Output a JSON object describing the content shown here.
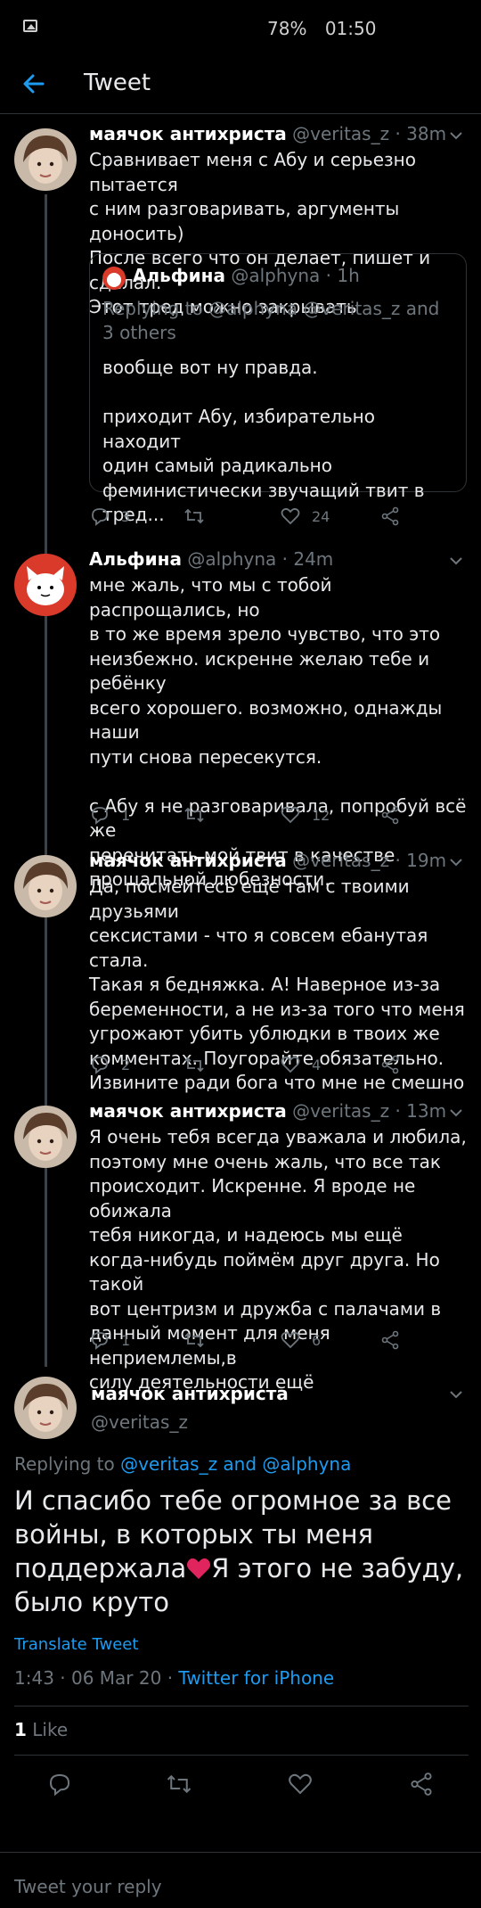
{
  "status_bar": {
    "battery": "78%",
    "time": "01:50"
  },
  "header": {
    "title": "Tweet"
  },
  "tweets": [
    {
      "name": "маячок антихриста",
      "handle": "@veritas_z",
      "time": "· 38m",
      "text": "Сравнивает меня с Абу и серьезно пытается\nс ним разговаривать, аргументы доносить)\nПосле всего что он делает, пишет и сделал.\nЭтот тред можно закрывать",
      "quote": {
        "name": "Альфина",
        "handle": "@alphyna",
        "time": "· 1h",
        "replying": "Replying to @alphyna @veritas_z and 3 others",
        "text": "вообще вот ну правда.\n\nприходит Абу, избирательно находит\nодин самый радикально\nфеминистически звучащий твит в тред..."
      },
      "replies": "3",
      "retweets": "",
      "likes": "24"
    },
    {
      "name": "Альфина",
      "handle": "@alphyna",
      "time": "· 24m",
      "text": "мне жаль, что мы с тобой распрощались, но\nв то же время зрело чувство, что это\nнеизбежно. искренне желаю тебе и ребёнку\nвсего хорошего. возможно, однажды наши\nпути снова пересекутся.\n\nс Абу я не разговаривала, попробуй всё же\nперечитать мой твит в качестве\nпрощальной любезности.",
      "replies": "1",
      "retweets": "",
      "likes": "12"
    },
    {
      "name": "маячок антихриста",
      "handle": "@veritas_z",
      "time": "· 19m",
      "text": "Да, посмейтесь ещё там с твоими друзьями\nсексистами - что я совсем ебанутая стала.\nТакая я бедняжка. А! Наверное из-за\nбеременности, а не из-за того что меня\nугрожают убить ублюдки в твоих же\nкомментах. Поугорайте обязательно.\nИзвините ради бога что мне не смешно",
      "replies": "2",
      "retweets": "",
      "likes": "4"
    },
    {
      "name": "маячок антихриста",
      "handle": "@veritas_z",
      "time": "· 13m",
      "text": "Я очень тебя всегда уважала и любила,\nпоэтому мне очень жаль, что все так\nпроисходит. Искренне. Я вроде не обижала\nтебя никогда, и надеюсь мы ещё\nкогда-нибудь поймём друг друга. Но такой\nвот центризм и дружба с палачами в\nданный момент для меня неприемлемы,в\nсилу деятельности ещё",
      "replies": "1",
      "retweets": "",
      "likes": "6"
    }
  ],
  "main_tweet": {
    "name": "маячок антихриста",
    "handle": "@veritas_z",
    "replying_prefix": "Replying to",
    "replying_users": "@veritas_z and @alphyna",
    "text_before_emoji": "И спасибо тебе огромное за все войны, в которых ты меня поддержала",
    "emoji": "red-heart-emoji",
    "text_after_emoji": "Я этого не забуду, было круто",
    "translate": "Translate Tweet",
    "timestamp": "1:43 · 06 Mar 20 ·",
    "source": "Twitter for iPhone",
    "like_count": "1",
    "like_label": "Like"
  },
  "reply_bar": {
    "placeholder": "Tweet your reply"
  },
  "colors": {
    "accent": "#1d9bf0",
    "muted": "#6e767d",
    "background": "#000000",
    "heart": "#e0245e"
  }
}
